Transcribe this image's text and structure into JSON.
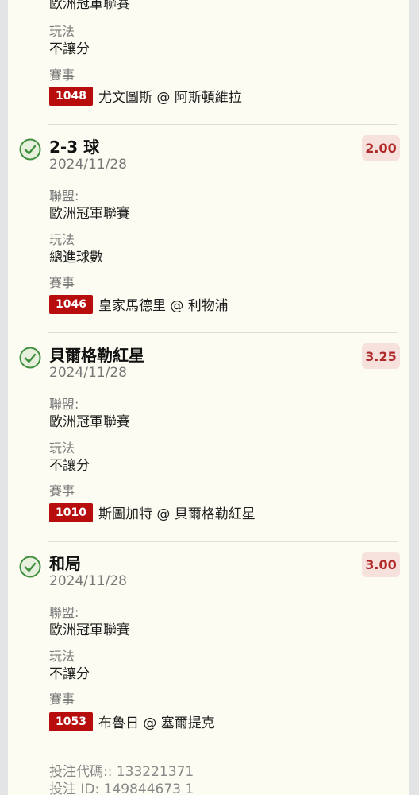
{
  "labels": {
    "league": "聯盟:",
    "play": "玩法",
    "event": "賽事"
  },
  "top_partial": {
    "league_value_clipped": "歐洲冠軍聯賽",
    "play_value": "不讓分",
    "event_code": "1048",
    "event_match": "尤文圖斯 @ 阿斯頓維拉"
  },
  "bets": [
    {
      "selection": "2-3 球",
      "date": "2024/11/28",
      "odds": "2.00",
      "league": "歐洲冠軍聯賽",
      "play": "總進球數",
      "event_code": "1046",
      "event_match": "皇家馬德里 @ 利物浦"
    },
    {
      "selection": "貝爾格勒紅星",
      "date": "2024/11/28",
      "odds": "3.25",
      "league": "歐洲冠軍聯賽",
      "play": "不讓分",
      "event_code": "1010",
      "event_match": "斯圖加特 @ 貝爾格勒紅星"
    },
    {
      "selection": "和局",
      "date": "2024/11/28",
      "odds": "3.00",
      "league": "歐洲冠軍聯賽",
      "play": "不讓分",
      "event_code": "1053",
      "event_match": "布魯日 @ 塞爾提克"
    }
  ],
  "footer": {
    "bet_code": "投注代碼:: 133221371",
    "bet_id_partial": "投注 ID: 149844673 1"
  },
  "colors": {
    "odds_text": "#b02a2a",
    "odds_bg": "#f7e1dd",
    "code_badge": "#b70d0d",
    "check": "#3f8f3f"
  }
}
